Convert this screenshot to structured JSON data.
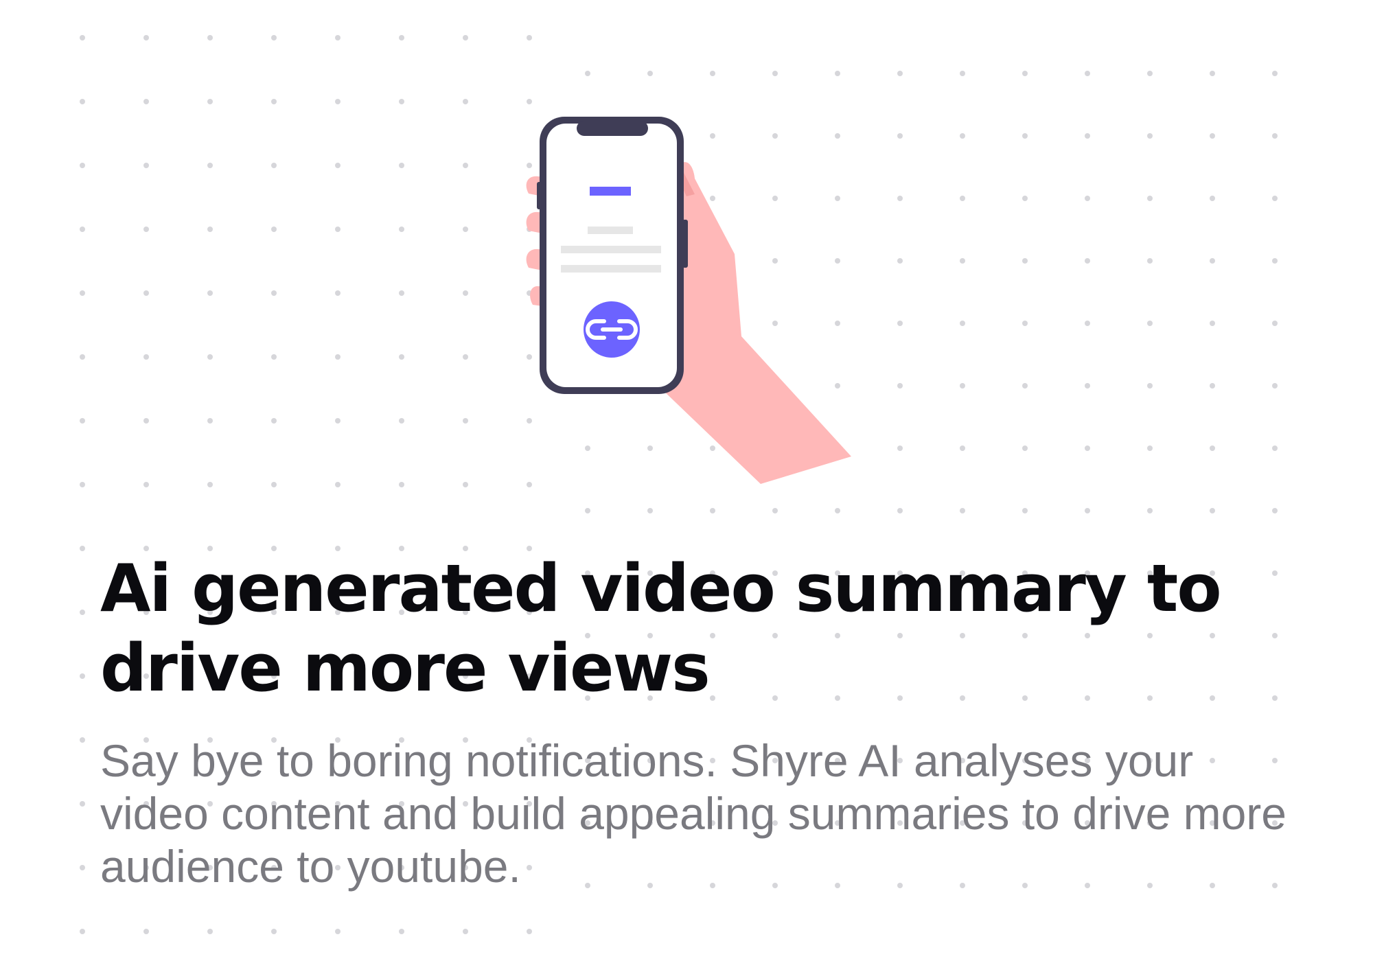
{
  "card": {
    "title": "Ai generated video summary to drive more views",
    "description": "Say bye to boring notifications. Shyre AI analyses your video content and build appealing summaries to drive more audience to youtube."
  },
  "illustration": {
    "icon": "link-icon",
    "accent_color": "#6c63ff",
    "phone_frame_color": "#3f3d56",
    "hand_color": "#ffb8b8"
  }
}
